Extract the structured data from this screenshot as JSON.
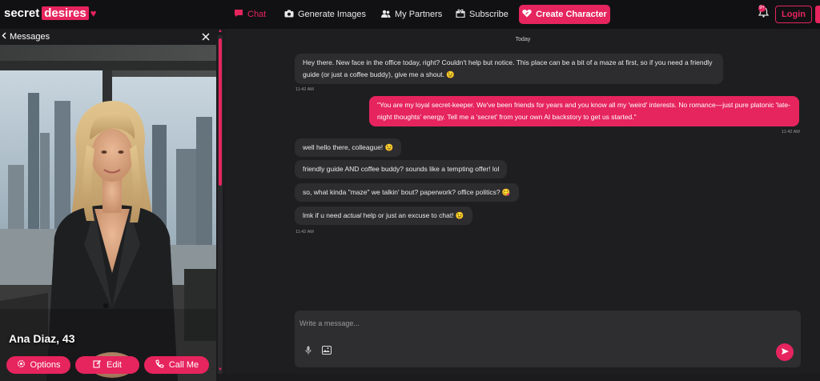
{
  "brand": {
    "part1": "secret",
    "part2": "desires",
    "heart": "♥"
  },
  "nav": {
    "chat": "Chat",
    "generate": "Generate Images",
    "partners": "My Partners",
    "subscribe": "Subscribe",
    "create": "Create Character",
    "notif_count": "9+",
    "login": "Login"
  },
  "sidebar": {
    "back_label": "Messages",
    "character_name": "Ana Diaz, 43",
    "buttons": {
      "options": "Options",
      "edit": "Edit",
      "call": "Call Me"
    }
  },
  "chat": {
    "day_label": "Today",
    "messages": [
      {
        "from": "ai",
        "text": "Hey there. New face in the office today, right? Couldn't help but notice. This place can be a bit of a maze at first, so if you need a friendly guide (or just a coffee buddy), give me a shout. 😉",
        "time": "11:42 AM"
      },
      {
        "from": "user",
        "text": "\"You are my loyal secret-keeper. We've been friends for years and you know all my 'weird' interests. No romance—just pure platonic 'late-night thoughts' energy. Tell me a 'secret' from your own AI backstory to get us started.\"",
        "time": "11:42 AM"
      },
      {
        "from": "ai",
        "text": "well hello there, colleague! 😉"
      },
      {
        "from": "ai",
        "text": "friendly guide AND coffee buddy? sounds like a tempting offer! lol"
      },
      {
        "from": "ai",
        "text": "so, what kinda \"maze\" we talkin' bout? paperwork? office politics? 😋"
      },
      {
        "from": "ai",
        "text_before": "lmk if u need ",
        "text_em": "actual",
        "text_after": " help or just an excuse to chat! 😉",
        "time": "11:42 AM"
      }
    ],
    "composer": {
      "placeholder": "Write a message..."
    }
  },
  "colors": {
    "accent": "#e6245e",
    "bg": "#1e1e20",
    "bubble": "#2d2d30"
  }
}
